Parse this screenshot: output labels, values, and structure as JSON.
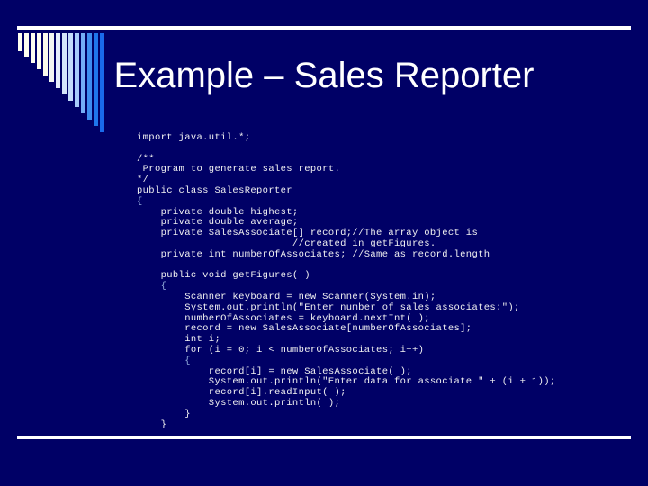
{
  "slide": {
    "title": "Example – Sales Reporter",
    "background_color": "#000066",
    "rule_color": "#ffffff",
    "title_color": "#ffffff",
    "code_color": "#f2f2f2",
    "brace_color": "#8fa8d8"
  },
  "decoration": {
    "name": "gradient-stair-bars",
    "bar_count": 14,
    "colors": [
      "#fffff0",
      "#fffff0",
      "#fffff0",
      "#fffff0",
      "#fbfbec",
      "#f2f6f2",
      "#e4eefb",
      "#d4e4fb",
      "#c4dcfb",
      "#a8ccfa",
      "#74adf6",
      "#3d8df0",
      "#1f76ec",
      "#1a6aec"
    ],
    "heights": [
      20,
      26,
      33,
      40,
      47,
      54,
      61,
      68,
      75,
      82,
      89,
      96,
      103,
      110
    ]
  },
  "code": {
    "language": "java",
    "lines": [
      "import java.util.*;",
      "",
      "/**",
      " Program to generate sales report.",
      "*/",
      "public class SalesReporter",
      "{",
      "    private double highest;",
      "    private double average;",
      "    private SalesAssociate[] record;//The array object is",
      "                          //created in getFigures.",
      "    private int numberOfAssociates; //Same as record.length",
      "",
      "    public void getFigures( )",
      "    {",
      "        Scanner keyboard = new Scanner(System.in);",
      "        System.out.println(\"Enter number of sales associates:\");",
      "        numberOfAssociates = keyboard.nextInt( );",
      "        record = new SalesAssociate[numberOfAssociates];",
      "        int i;",
      "        for (i = 0; i < numberOfAssociates; i++)",
      "        {",
      "            record[i] = new SalesAssociate( );",
      "            System.out.println(\"Enter data for associate \" + (i + 1));",
      "            record[i].readInput( );",
      "            System.out.println( );",
      "        }",
      "    }"
    ],
    "brace_lines": [
      6,
      14,
      21
    ]
  }
}
